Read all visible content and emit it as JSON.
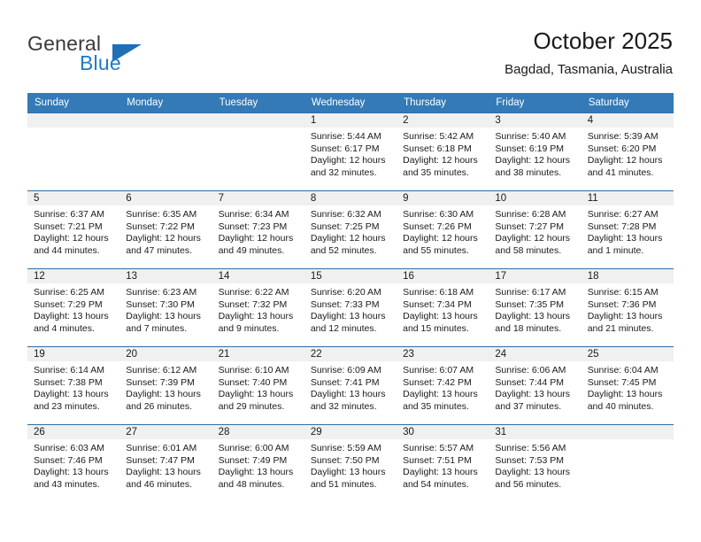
{
  "brand": {
    "name_part1": "General",
    "name_part2": "Blue",
    "accent_color": "#1f7ac4"
  },
  "header": {
    "title": "October 2025",
    "subtitle": "Bagdad, Tasmania, Australia"
  },
  "calendar": {
    "header_bg": "#337ab7",
    "weekdays": [
      "Sunday",
      "Monday",
      "Tuesday",
      "Wednesday",
      "Thursday",
      "Friday",
      "Saturday"
    ],
    "weeks": [
      [
        {
          "empty": true
        },
        {
          "empty": true
        },
        {
          "empty": true
        },
        {
          "day": "1",
          "sunrise": "Sunrise: 5:44 AM",
          "sunset": "Sunset: 6:17 PM",
          "daylight1": "Daylight: 12 hours",
          "daylight2": "and 32 minutes."
        },
        {
          "day": "2",
          "sunrise": "Sunrise: 5:42 AM",
          "sunset": "Sunset: 6:18 PM",
          "daylight1": "Daylight: 12 hours",
          "daylight2": "and 35 minutes."
        },
        {
          "day": "3",
          "sunrise": "Sunrise: 5:40 AM",
          "sunset": "Sunset: 6:19 PM",
          "daylight1": "Daylight: 12 hours",
          "daylight2": "and 38 minutes."
        },
        {
          "day": "4",
          "sunrise": "Sunrise: 5:39 AM",
          "sunset": "Sunset: 6:20 PM",
          "daylight1": "Daylight: 12 hours",
          "daylight2": "and 41 minutes."
        }
      ],
      [
        {
          "day": "5",
          "sunrise": "Sunrise: 6:37 AM",
          "sunset": "Sunset: 7:21 PM",
          "daylight1": "Daylight: 12 hours",
          "daylight2": "and 44 minutes."
        },
        {
          "day": "6",
          "sunrise": "Sunrise: 6:35 AM",
          "sunset": "Sunset: 7:22 PM",
          "daylight1": "Daylight: 12 hours",
          "daylight2": "and 47 minutes."
        },
        {
          "day": "7",
          "sunrise": "Sunrise: 6:34 AM",
          "sunset": "Sunset: 7:23 PM",
          "daylight1": "Daylight: 12 hours",
          "daylight2": "and 49 minutes."
        },
        {
          "day": "8",
          "sunrise": "Sunrise: 6:32 AM",
          "sunset": "Sunset: 7:25 PM",
          "daylight1": "Daylight: 12 hours",
          "daylight2": "and 52 minutes."
        },
        {
          "day": "9",
          "sunrise": "Sunrise: 6:30 AM",
          "sunset": "Sunset: 7:26 PM",
          "daylight1": "Daylight: 12 hours",
          "daylight2": "and 55 minutes."
        },
        {
          "day": "10",
          "sunrise": "Sunrise: 6:28 AM",
          "sunset": "Sunset: 7:27 PM",
          "daylight1": "Daylight: 12 hours",
          "daylight2": "and 58 minutes."
        },
        {
          "day": "11",
          "sunrise": "Sunrise: 6:27 AM",
          "sunset": "Sunset: 7:28 PM",
          "daylight1": "Daylight: 13 hours",
          "daylight2": "and 1 minute."
        }
      ],
      [
        {
          "day": "12",
          "sunrise": "Sunrise: 6:25 AM",
          "sunset": "Sunset: 7:29 PM",
          "daylight1": "Daylight: 13 hours",
          "daylight2": "and 4 minutes."
        },
        {
          "day": "13",
          "sunrise": "Sunrise: 6:23 AM",
          "sunset": "Sunset: 7:30 PM",
          "daylight1": "Daylight: 13 hours",
          "daylight2": "and 7 minutes."
        },
        {
          "day": "14",
          "sunrise": "Sunrise: 6:22 AM",
          "sunset": "Sunset: 7:32 PM",
          "daylight1": "Daylight: 13 hours",
          "daylight2": "and 9 minutes."
        },
        {
          "day": "15",
          "sunrise": "Sunrise: 6:20 AM",
          "sunset": "Sunset: 7:33 PM",
          "daylight1": "Daylight: 13 hours",
          "daylight2": "and 12 minutes."
        },
        {
          "day": "16",
          "sunrise": "Sunrise: 6:18 AM",
          "sunset": "Sunset: 7:34 PM",
          "daylight1": "Daylight: 13 hours",
          "daylight2": "and 15 minutes."
        },
        {
          "day": "17",
          "sunrise": "Sunrise: 6:17 AM",
          "sunset": "Sunset: 7:35 PM",
          "daylight1": "Daylight: 13 hours",
          "daylight2": "and 18 minutes."
        },
        {
          "day": "18",
          "sunrise": "Sunrise: 6:15 AM",
          "sunset": "Sunset: 7:36 PM",
          "daylight1": "Daylight: 13 hours",
          "daylight2": "and 21 minutes."
        }
      ],
      [
        {
          "day": "19",
          "sunrise": "Sunrise: 6:14 AM",
          "sunset": "Sunset: 7:38 PM",
          "daylight1": "Daylight: 13 hours",
          "daylight2": "and 23 minutes."
        },
        {
          "day": "20",
          "sunrise": "Sunrise: 6:12 AM",
          "sunset": "Sunset: 7:39 PM",
          "daylight1": "Daylight: 13 hours",
          "daylight2": "and 26 minutes."
        },
        {
          "day": "21",
          "sunrise": "Sunrise: 6:10 AM",
          "sunset": "Sunset: 7:40 PM",
          "daylight1": "Daylight: 13 hours",
          "daylight2": "and 29 minutes."
        },
        {
          "day": "22",
          "sunrise": "Sunrise: 6:09 AM",
          "sunset": "Sunset: 7:41 PM",
          "daylight1": "Daylight: 13 hours",
          "daylight2": "and 32 minutes."
        },
        {
          "day": "23",
          "sunrise": "Sunrise: 6:07 AM",
          "sunset": "Sunset: 7:42 PM",
          "daylight1": "Daylight: 13 hours",
          "daylight2": "and 35 minutes."
        },
        {
          "day": "24",
          "sunrise": "Sunrise: 6:06 AM",
          "sunset": "Sunset: 7:44 PM",
          "daylight1": "Daylight: 13 hours",
          "daylight2": "and 37 minutes."
        },
        {
          "day": "25",
          "sunrise": "Sunrise: 6:04 AM",
          "sunset": "Sunset: 7:45 PM",
          "daylight1": "Daylight: 13 hours",
          "daylight2": "and 40 minutes."
        }
      ],
      [
        {
          "day": "26",
          "sunrise": "Sunrise: 6:03 AM",
          "sunset": "Sunset: 7:46 PM",
          "daylight1": "Daylight: 13 hours",
          "daylight2": "and 43 minutes."
        },
        {
          "day": "27",
          "sunrise": "Sunrise: 6:01 AM",
          "sunset": "Sunset: 7:47 PM",
          "daylight1": "Daylight: 13 hours",
          "daylight2": "and 46 minutes."
        },
        {
          "day": "28",
          "sunrise": "Sunrise: 6:00 AM",
          "sunset": "Sunset: 7:49 PM",
          "daylight1": "Daylight: 13 hours",
          "daylight2": "and 48 minutes."
        },
        {
          "day": "29",
          "sunrise": "Sunrise: 5:59 AM",
          "sunset": "Sunset: 7:50 PM",
          "daylight1": "Daylight: 13 hours",
          "daylight2": "and 51 minutes."
        },
        {
          "day": "30",
          "sunrise": "Sunrise: 5:57 AM",
          "sunset": "Sunset: 7:51 PM",
          "daylight1": "Daylight: 13 hours",
          "daylight2": "and 54 minutes."
        },
        {
          "day": "31",
          "sunrise": "Sunrise: 5:56 AM",
          "sunset": "Sunset: 7:53 PM",
          "daylight1": "Daylight: 13 hours",
          "daylight2": "and 56 minutes."
        },
        {
          "empty": true
        }
      ]
    ]
  }
}
